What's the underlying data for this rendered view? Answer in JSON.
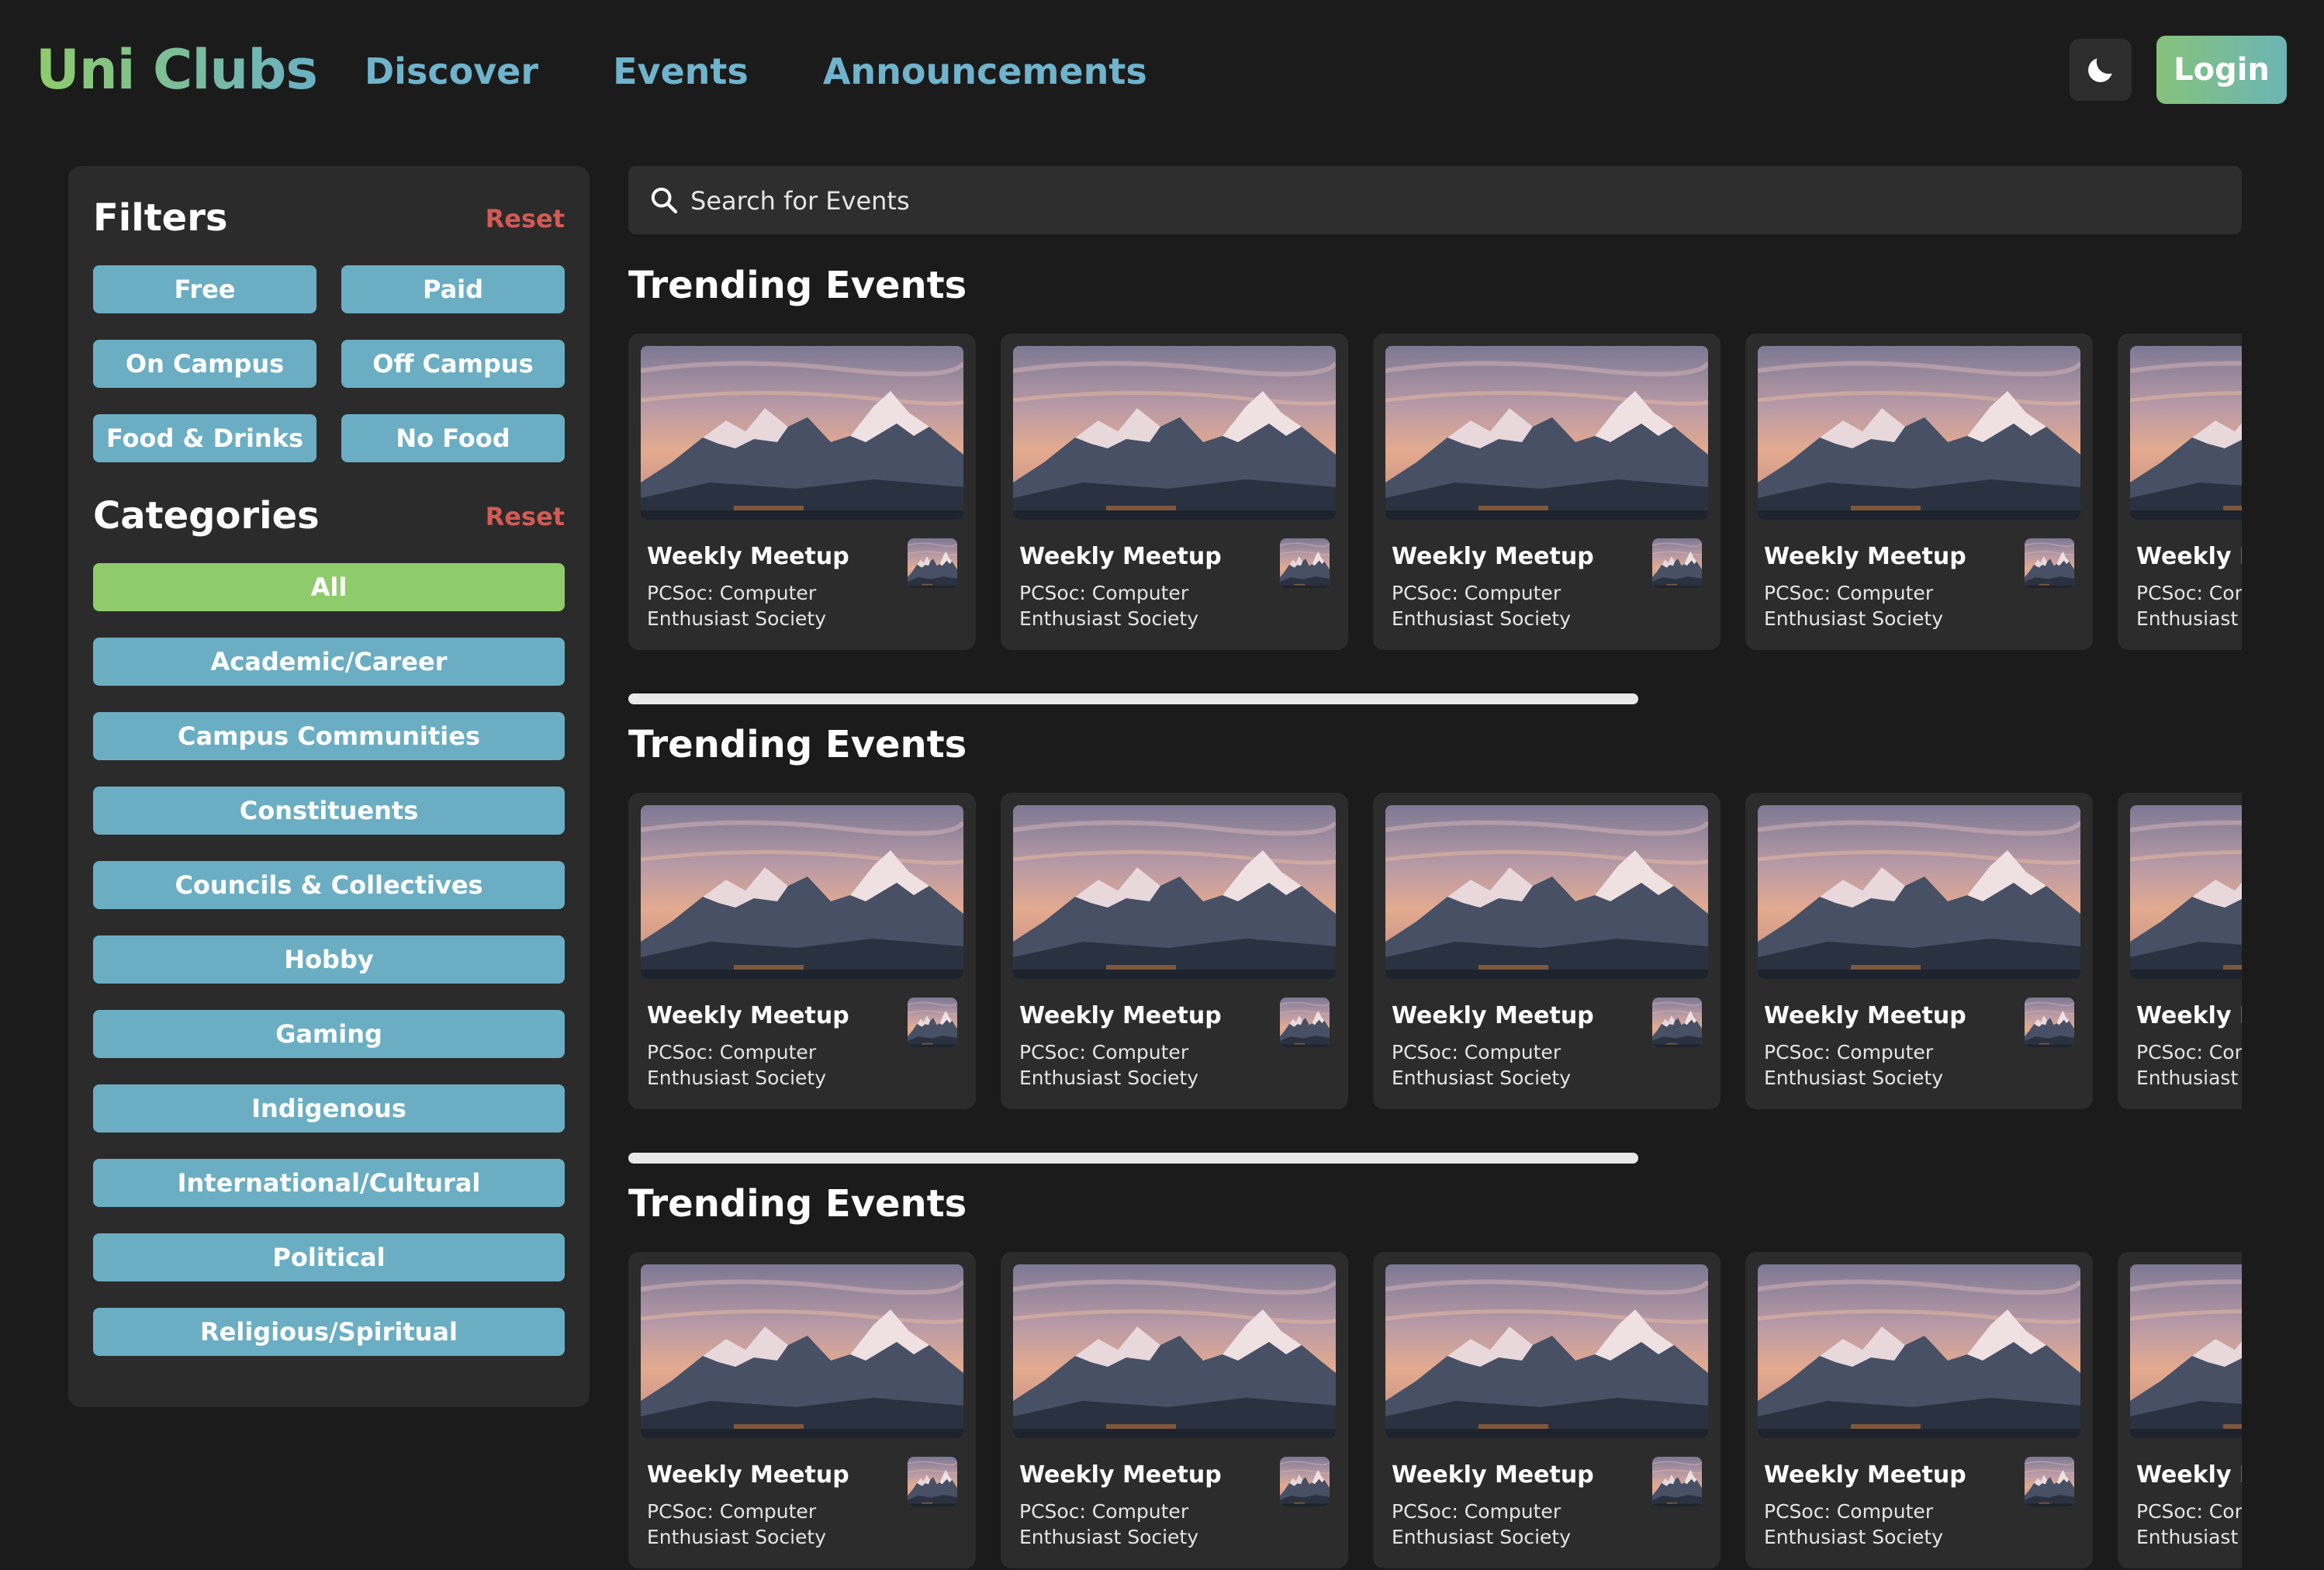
{
  "header": {
    "brand": "Uni Clubs",
    "nav": [
      "Discover",
      "Events",
      "Announcements"
    ],
    "theme_icon": "moon-icon",
    "login_label": "Login"
  },
  "filters": {
    "title": "Filters",
    "reset_label": "Reset",
    "options": [
      "Free",
      "Paid",
      "On Campus",
      "Off Campus",
      "Food & Drinks",
      "No Food"
    ]
  },
  "categories": {
    "title": "Categories",
    "reset_label": "Reset",
    "items": [
      "All",
      "Academic/Career",
      "Campus Communities",
      "Constituents",
      "Councils & Collectives",
      "Hobby",
      "Gaming",
      "Indigenous",
      "International/Cultural",
      "Political",
      "Religious/Spiritual"
    ],
    "active": "All"
  },
  "search": {
    "placeholder": "Search for Events",
    "icon": "search-icon"
  },
  "rows": [
    {
      "title": "Trending Events",
      "events": [
        {
          "title": "Weekly Meetup",
          "club": "PCSoc: Computer Enthusiast Society"
        },
        {
          "title": "Weekly Meetup",
          "club": "PCSoc: Computer Enthusiast Society"
        },
        {
          "title": "Weekly Meetup",
          "club": "PCSoc: Computer Enthusiast Society"
        },
        {
          "title": "Weekly Meetup",
          "club": "PCSoc: Computer Enthusiast Society"
        },
        {
          "title": "Weekly Meetup",
          "club": "PCSoc: Computer Enthusiast Society"
        }
      ]
    },
    {
      "title": "Trending Events",
      "events": [
        {
          "title": "Weekly Meetup",
          "club": "PCSoc: Computer Enthusiast Society"
        },
        {
          "title": "Weekly Meetup",
          "club": "PCSoc: Computer Enthusiast Society"
        },
        {
          "title": "Weekly Meetup",
          "club": "PCSoc: Computer Enthusiast Society"
        },
        {
          "title": "Weekly Meetup",
          "club": "PCSoc: Computer Enthusiast Society"
        },
        {
          "title": "Weekly Meetup",
          "club": "PCSoc: Computer Enthusiast Society"
        }
      ]
    },
    {
      "title": "Trending Events",
      "events": [
        {
          "title": "Weekly Meetup",
          "club": "PCSoc: Computer Enthusiast Society"
        },
        {
          "title": "Weekly Meetup",
          "club": "PCSoc: Computer Enthusiast Society"
        },
        {
          "title": "Weekly Meetup",
          "club": "PCSoc: Computer Enthusiast Society"
        },
        {
          "title": "Weekly Meetup",
          "club": "PCSoc: Computer Enthusiast Society"
        },
        {
          "title": "Weekly Meetup",
          "club": "PCSoc: Computer Enthusiast Society"
        }
      ]
    }
  ],
  "colors": {
    "background": "#1b1b1b",
    "panel": "#2b2b2b",
    "accent_blue": "#6baec3",
    "accent_green": "#8fcb6b",
    "reset_red": "#d45a55"
  }
}
